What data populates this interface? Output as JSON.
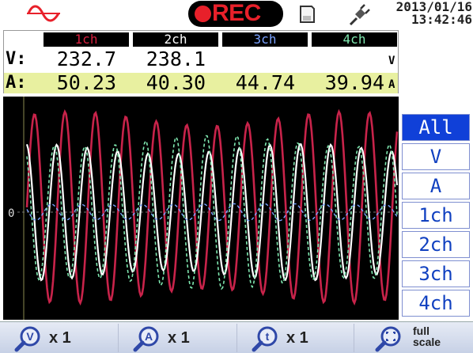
{
  "status_bar": {
    "rec_label": "REC",
    "date": "2013/01/16",
    "time": "13:42:46",
    "colors": {
      "rec": "#e8202a",
      "wave_icon": "#e8202a"
    },
    "icons": [
      "sine-wave-icon",
      "record-dot-icon",
      "sd-card-icon",
      "power-plug-icon"
    ]
  },
  "measurements": {
    "channels": [
      {
        "label": "1ch",
        "color": "#c8234a"
      },
      {
        "label": "2ch",
        "color": "#ffffff"
      },
      {
        "label": "3ch",
        "color": "#7aa2ff"
      },
      {
        "label": "4ch",
        "color": "#7fe8b0"
      }
    ],
    "voltage": {
      "label": "V:",
      "unit": "V",
      "values": [
        "232.7",
        "238.1",
        "",
        ""
      ]
    },
    "current": {
      "label": "A:",
      "unit": "A",
      "values": [
        "50.23",
        "40.30",
        "44.74",
        "39.94"
      ]
    }
  },
  "waveform": {
    "zero_label": "0",
    "traces": [
      {
        "channel": "1ch",
        "color": "#c8234a",
        "style": "solid"
      },
      {
        "channel": "2ch",
        "color": "#ffffff",
        "style": "solid"
      },
      {
        "channel": "3ch",
        "color": "#7aa2ff",
        "style": "dashed"
      },
      {
        "channel": "4ch",
        "color": "#7fe8b0",
        "style": "dashed"
      }
    ]
  },
  "side_buttons": {
    "items": [
      "All",
      "V",
      "A",
      "1ch",
      "2ch",
      "3ch",
      "4ch"
    ],
    "active": "All"
  },
  "bottom_bar": {
    "voltage_zoom": "x 1",
    "current_zoom": "x 1",
    "time_zoom": "x 1",
    "full_scale_line1": "full",
    "full_scale_line2": "scale",
    "icons": [
      "voltage-zoom-icon",
      "current-zoom-icon",
      "time-zoom-icon",
      "full-scale-icon"
    ]
  }
}
